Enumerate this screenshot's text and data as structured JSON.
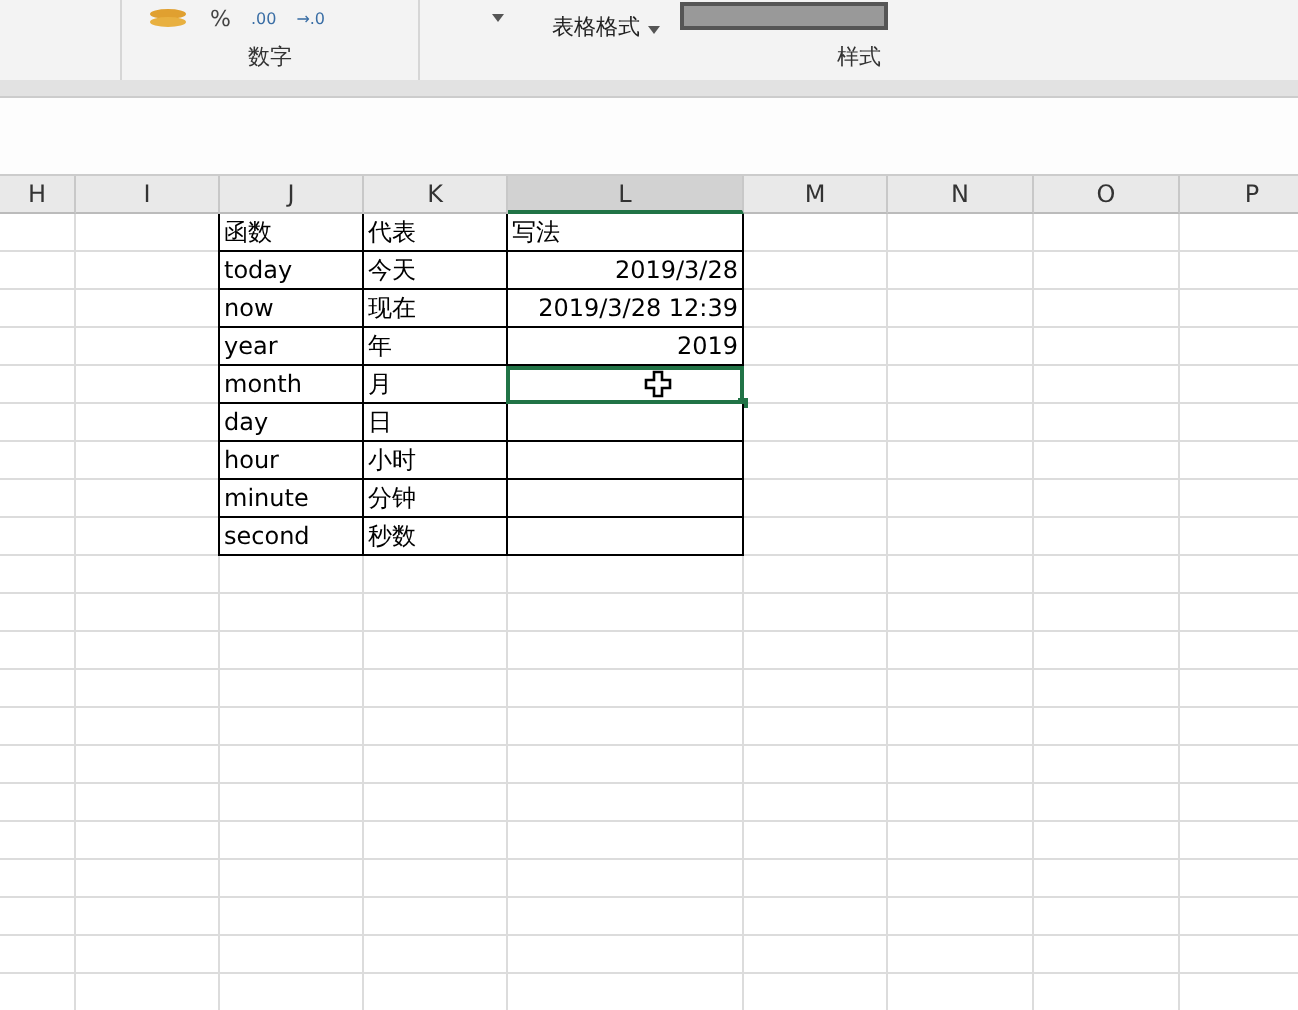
{
  "ribbon": {
    "number_format": "%",
    "decimal_buttons": [
      ".00",
      "→.0"
    ],
    "table_format": "表格格式",
    "groups": [
      {
        "label": "数字"
      },
      {
        "label": "样式"
      }
    ]
  },
  "columns": [
    {
      "label": "H",
      "selected": false
    },
    {
      "label": "I",
      "selected": false
    },
    {
      "label": "J",
      "selected": false
    },
    {
      "label": "K",
      "selected": false
    },
    {
      "label": "L",
      "selected": true
    },
    {
      "label": "M",
      "selected": false
    },
    {
      "label": "N",
      "selected": false
    },
    {
      "label": "O",
      "selected": false
    },
    {
      "label": "P",
      "selected": false
    }
  ],
  "rows": [
    {
      "cells": [
        {
          "text": "函数",
          "kind": "text",
          "selected": false
        },
        {
          "text": "代表",
          "kind": "text",
          "selected": false
        },
        {
          "text": "写法",
          "kind": "text",
          "selected": false
        }
      ]
    },
    {
      "cells": [
        {
          "text": "today",
          "kind": "text",
          "selected": false
        },
        {
          "text": "今天",
          "kind": "text",
          "selected": false
        },
        {
          "text": "2019/3/28",
          "kind": "number",
          "selected": false
        }
      ]
    },
    {
      "cells": [
        {
          "text": "now",
          "kind": "text",
          "selected": false
        },
        {
          "text": "现在",
          "kind": "text",
          "selected": false
        },
        {
          "text": "2019/3/28 12:39",
          "kind": "number",
          "selected": false
        }
      ]
    },
    {
      "cells": [
        {
          "text": "year",
          "kind": "text",
          "selected": false
        },
        {
          "text": "年",
          "kind": "text",
          "selected": false
        },
        {
          "text": "2019",
          "kind": "number",
          "selected": false
        }
      ]
    },
    {
      "cells": [
        {
          "text": "month",
          "kind": "text",
          "selected": false
        },
        {
          "text": "月",
          "kind": "text",
          "selected": false
        },
        {
          "selected": true
        }
      ]
    },
    {
      "cells": [
        {
          "text": "day",
          "kind": "text",
          "selected": false
        },
        {
          "text": "日",
          "kind": "text",
          "selected": false
        },
        {
          "selected": false
        }
      ]
    },
    {
      "cells": [
        {
          "text": "hour",
          "kind": "text",
          "selected": false
        },
        {
          "text": "小时",
          "kind": "text",
          "selected": false
        },
        {
          "selected": false
        }
      ]
    },
    {
      "cells": [
        {
          "text": "minute",
          "kind": "text",
          "selected": false
        },
        {
          "text": "分钟",
          "kind": "text",
          "selected": false
        },
        {
          "selected": false
        }
      ]
    },
    {
      "cells": [
        {
          "text": "second",
          "kind": "text",
          "selected": false
        },
        {
          "text": "秒数",
          "kind": "text",
          "selected": false
        },
        {
          "selected": false
        }
      ]
    }
  ]
}
